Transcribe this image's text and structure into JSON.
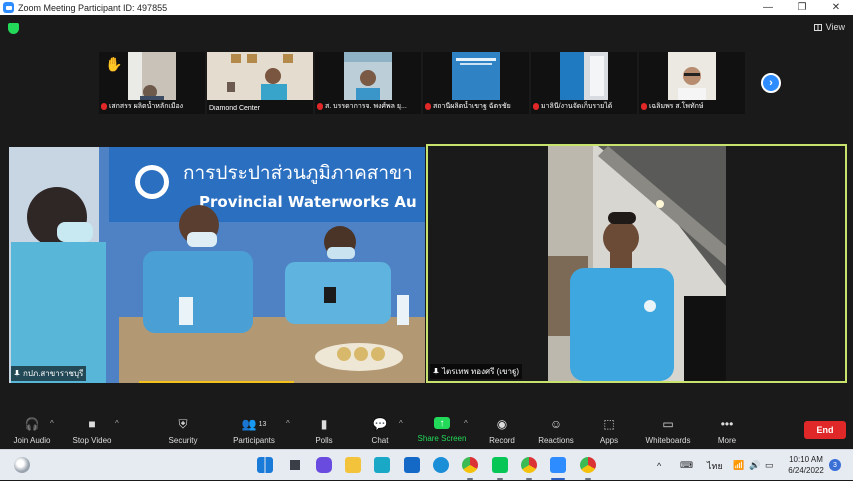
{
  "window": {
    "title": "Zoom Meeting Participant ID: 497855",
    "minimize_glyph": "—",
    "restore_glyph": "❐",
    "close_glyph": "✕"
  },
  "meeting": {
    "view_label": "View",
    "encryption_icon": "shield-icon",
    "next_page_glyph": "›"
  },
  "thumbnails": [
    {
      "name": "เสกสรร   ผลิตน้ำหลักเมือง",
      "muted": true,
      "raised_hand": true
    },
    {
      "name": "Diamond Center",
      "muted": false,
      "raised_hand": false
    },
    {
      "name": "ส. บรรดาการจ. พงศ์พล  ยุ...",
      "muted": true,
      "raised_hand": false
    },
    {
      "name": "สถานีผลิตน้ำเขาฐ ฉัตรชัย",
      "muted": true,
      "raised_hand": false
    },
    {
      "name": "มาลินี/งานจัดเก็บรายได้",
      "muted": true,
      "raised_hand": false
    },
    {
      "name": "เฉลิมพร ส.โพทักษ์",
      "muted": true,
      "raised_hand": false
    }
  ],
  "main_tiles": {
    "left": {
      "name": "กปภ.สาขาราชบุรี",
      "banner_th": "การประปาส่วนภูมิภาคสาขา",
      "banner_en": "Provincial Waterworks Au"
    },
    "right": {
      "name": "ไตรเทพ ทองศรี (เขาฐู)"
    }
  },
  "toolbar": {
    "join_audio": "Join Audio",
    "stop_video": "Stop Video",
    "security": "Security",
    "participants": "Participants",
    "participants_count": "13",
    "polls": "Polls",
    "chat": "Chat",
    "share_screen": "Share Screen",
    "record": "Record",
    "reactions": "Reactions",
    "apps": "Apps",
    "whiteboards": "Whiteboards",
    "more": "More",
    "end": "End",
    "caret": "^"
  },
  "taskbar": {
    "lang": "ไทย",
    "time": "10:10 AM",
    "date": "6/24/2022",
    "notifications": "3",
    "tray_up": "^"
  },
  "colors": {
    "accent": "#2d8cff",
    "active_speaker_border": "#c7e26d",
    "end_button": "#e02828",
    "share_green": "#23d959"
  }
}
